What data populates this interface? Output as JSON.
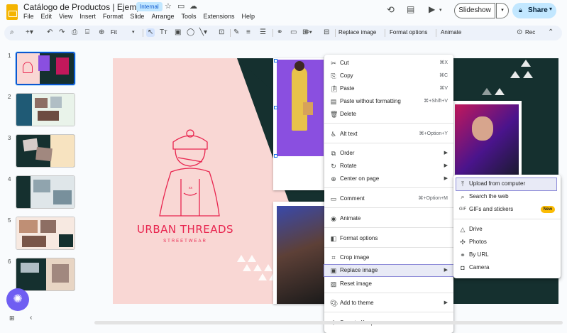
{
  "header": {
    "doc_title": "Catálogo de Productos | Ejemplo",
    "badge": "Internal",
    "slideshow_label": "Slideshow",
    "share_label": "Share",
    "menus": [
      "File",
      "Edit",
      "View",
      "Insert",
      "Format",
      "Slide",
      "Arrange",
      "Tools",
      "Extensions",
      "Help"
    ]
  },
  "toolbar": {
    "zoom_label": "Fit",
    "replace_image": "Replace image",
    "format_options": "Format options",
    "animate": "Animate",
    "rec": "Rec"
  },
  "slides": {
    "numbers": [
      "1",
      "2",
      "3",
      "4",
      "5",
      "6"
    ]
  },
  "canvas": {
    "brand_title": "URBAN THREADS",
    "brand_subtitle": "STREETWEAR",
    "bear_mark": "xx"
  },
  "context_menu": {
    "cut": {
      "label": "Cut",
      "shortcut": "⌘X"
    },
    "copy": {
      "label": "Copy",
      "shortcut": "⌘C"
    },
    "paste": {
      "label": "Paste",
      "shortcut": "⌘V"
    },
    "paste_plain": {
      "label": "Paste without formatting",
      "shortcut": "⌘+Shift+V"
    },
    "delete": {
      "label": "Delete"
    },
    "alt_text": {
      "label": "Alt text",
      "shortcut": "⌘+Option+Y"
    },
    "order": {
      "label": "Order"
    },
    "rotate": {
      "label": "Rotate"
    },
    "center": {
      "label": "Center on page"
    },
    "comment": {
      "label": "Comment",
      "shortcut": "⌘+Option+M"
    },
    "animate": {
      "label": "Animate"
    },
    "format_options": {
      "label": "Format options"
    },
    "crop": {
      "label": "Crop image"
    },
    "replace": {
      "label": "Replace image"
    },
    "reset": {
      "label": "Reset image"
    },
    "add_theme": {
      "label": "Add to theme"
    },
    "keep": {
      "label": "Save to Keep"
    }
  },
  "submenu": {
    "upload": "Upload from computer",
    "search": "Search the web",
    "gifs": "GIFs and stickers",
    "new_badge": "New",
    "drive": "Drive",
    "photos": "Photos",
    "url": "By URL",
    "camera": "Camera"
  },
  "colors": {
    "pink": "#f9d7d4",
    "teal": "#15302f",
    "brand_red": "#e8254f",
    "purple": "#8a4fe0",
    "accent": "#0b57d0"
  }
}
